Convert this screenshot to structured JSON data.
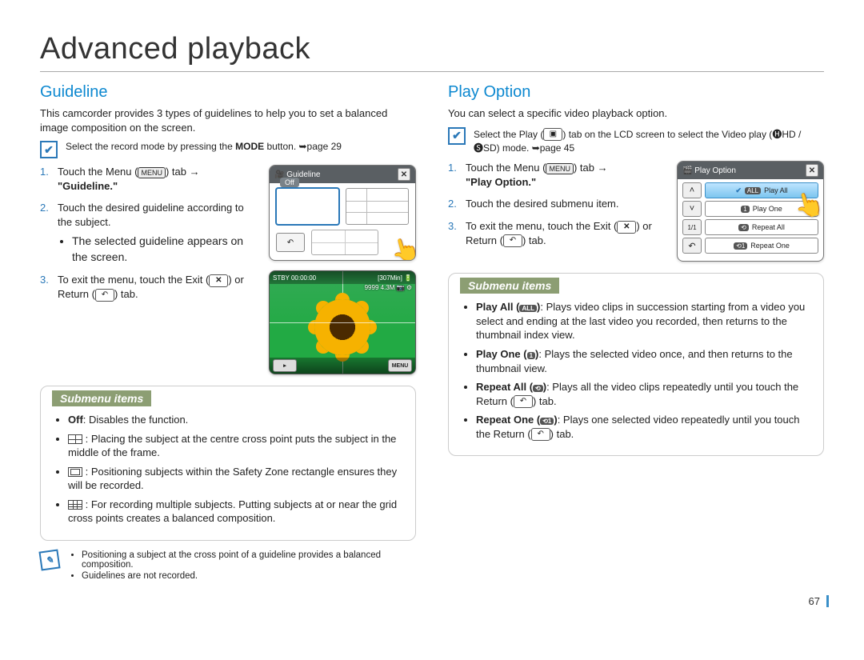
{
  "page": {
    "title": "Advanced playback",
    "number": "67"
  },
  "guideline": {
    "heading": "Guideline",
    "intro": "This camcorder provides 3 types of guidelines to help you to set a balanced image composition on the screen.",
    "precheck_prefix": "Select the record mode by pressing the ",
    "precheck_bold": "MODE",
    "precheck_suffix": " button. ➥page 29",
    "step1_a": "Touch the Menu (",
    "step1_menu": "MENU",
    "step1_b": ") tab →",
    "step1_quote": "\"Guideline.\"",
    "step2": "Touch the desired guideline according to the subject.",
    "step2_bullet": "The selected guideline appears on the screen.",
    "step3_a": "To exit the menu, touch the Exit (",
    "step3_b": ") or Return (",
    "step3_c": ") tab.",
    "icon_x": "✕",
    "icon_return": "↶",
    "fig1": {
      "title": "Guideline",
      "off": "Off",
      "hand": "👆"
    },
    "preview": {
      "top_left": "STBY  00:00:00",
      "top_right": "[307Min]  🔋",
      "line2": "9999  4.3M  📷 ⚙",
      "menu": "MENU",
      "play": "▸"
    },
    "submenu": {
      "title": "Submenu items",
      "off_bold": "Off",
      "off_desc": ": Disables the function.",
      "cross_desc": ": Placing the subject at the centre cross point puts the subject in the middle of the frame.",
      "safe_desc": ": Positioning subjects within the Safety Zone rectangle ensures they will be recorded.",
      "grid_desc": ": For recording multiple subjects. Putting subjects at or near the grid cross points creates a balanced composition."
    },
    "notes": {
      "n1": "Positioning a subject at the cross point of a guideline provides a balanced composition.",
      "n2": "Guidelines are not recorded."
    }
  },
  "playOption": {
    "heading": "Play Option",
    "intro": "You can select a specific video playback option.",
    "precheck_a": "Select the Play (",
    "precheck_play": "▣",
    "precheck_b": ") tab on the LCD screen to select the Video play (",
    "precheck_mode": "🅗HD / 🅢SD",
    "precheck_c": ") mode. ➥page 45",
    "step1_a": "Touch the Menu (",
    "step1_menu": "MENU",
    "step1_b": ") tab →",
    "step1_quote": "\"Play Option.\"",
    "step2": "Touch the desired submenu item.",
    "step3_a": "To exit the menu, touch the Exit (",
    "step3_b": ") or Return (",
    "step3_c": ") tab.",
    "icon_x": "✕",
    "icon_return": "↶",
    "fig": {
      "title": "Play Option",
      "items": {
        "playAll": {
          "badge": "ALL",
          "label": "Play All",
          "check": "✔"
        },
        "playOne": {
          "badge": "1",
          "label": "Play One"
        },
        "repeatAll": {
          "badge": "⟲",
          "label": "Repeat All"
        },
        "repeatOne": {
          "badge": "⟲1",
          "label": "Repeat One"
        }
      },
      "nav": {
        "up": "˄",
        "down": "˅",
        "page": "1/1",
        "return": "↶"
      },
      "hand": "👆"
    },
    "submenu": {
      "title": "Submenu items",
      "playAll_bold": "Play All (",
      "playAll_badge": "ALL",
      "playAll_close": ")",
      "playAll_desc": ": Plays video clips in succession starting from a video you select and ending at the last video you recorded, then returns to the thumbnail index view.",
      "playOne_bold": "Play One (",
      "playOne_badge": "1",
      "playOne_close": ")",
      "playOne_desc": ": Plays the selected video once, and then returns to the thumbnail view.",
      "repeatAll_bold": "Repeat All (",
      "repeatAll_badge": "⟲",
      "repeatAll_close": ")",
      "repeatAll_desc_a": ": Plays all the video clips repeatedly until you touch the Return (",
      "repeatAll_desc_b": ") tab.",
      "repeatOne_bold": "Repeat One (",
      "repeatOne_badge": "⟲1",
      "repeatOne_close": ")",
      "repeatOne_desc_a": ": Plays one selected video repeatedly until you touch the Return (",
      "repeatOne_desc_b": ") tab."
    }
  }
}
